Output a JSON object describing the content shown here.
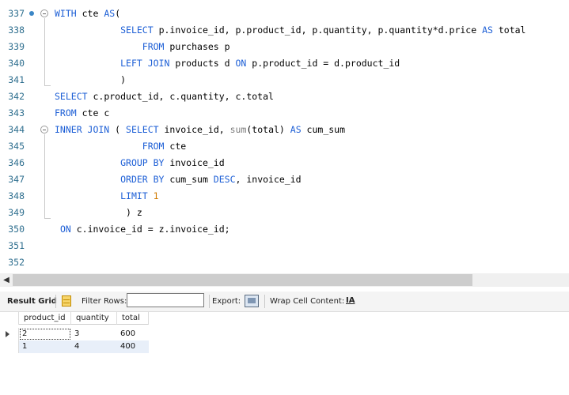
{
  "editor": {
    "lines": [
      {
        "num": "337",
        "tokens": [
          {
            "t": "WITH",
            "c": "kw"
          },
          {
            "t": " cte "
          },
          {
            "t": "AS",
            "c": "kw"
          },
          {
            "t": "("
          }
        ]
      },
      {
        "num": "338",
        "tokens": [
          {
            "t": "            "
          },
          {
            "t": "SELECT",
            "c": "kw"
          },
          {
            "t": " p.invoice_id, p.product_id, p.quantity, p.quantity*d.price "
          },
          {
            "t": "AS",
            "c": "kw"
          },
          {
            "t": " total"
          }
        ]
      },
      {
        "num": "339",
        "tokens": [
          {
            "t": "                "
          },
          {
            "t": "FROM",
            "c": "kw"
          },
          {
            "t": " purchases p"
          }
        ]
      },
      {
        "num": "340",
        "tokens": [
          {
            "t": "            "
          },
          {
            "t": "LEFT JOIN",
            "c": "kw"
          },
          {
            "t": " products d "
          },
          {
            "t": "ON",
            "c": "kw"
          },
          {
            "t": " p.product_id = d.product_id"
          }
        ]
      },
      {
        "num": "341",
        "tokens": [
          {
            "t": "            )"
          }
        ]
      },
      {
        "num": "342",
        "tokens": [
          {
            "t": "SELECT",
            "c": "kw"
          },
          {
            "t": " c.product_id, c.quantity, c.total"
          }
        ]
      },
      {
        "num": "343",
        "tokens": [
          {
            "t": "FROM",
            "c": "kw"
          },
          {
            "t": " cte c"
          }
        ]
      },
      {
        "num": "344",
        "tokens": [
          {
            "t": "INNER JOIN",
            "c": "kw"
          },
          {
            "t": " ( "
          },
          {
            "t": "SELECT",
            "c": "kw"
          },
          {
            "t": " invoice_id, "
          },
          {
            "t": "sum",
            "c": "fn"
          },
          {
            "t": "(total) "
          },
          {
            "t": "AS",
            "c": "kw"
          },
          {
            "t": " cum_sum"
          }
        ]
      },
      {
        "num": "345",
        "tokens": [
          {
            "t": "                "
          },
          {
            "t": "FROM",
            "c": "kw"
          },
          {
            "t": " cte"
          }
        ]
      },
      {
        "num": "346",
        "tokens": [
          {
            "t": "            "
          },
          {
            "t": "GROUP BY",
            "c": "kw"
          },
          {
            "t": " invoice_id"
          }
        ]
      },
      {
        "num": "347",
        "tokens": [
          {
            "t": "            "
          },
          {
            "t": "ORDER BY",
            "c": "kw"
          },
          {
            "t": " cum_sum "
          },
          {
            "t": "DESC",
            "c": "kw"
          },
          {
            "t": ", invoice_id"
          }
        ]
      },
      {
        "num": "348",
        "tokens": [
          {
            "t": "            "
          },
          {
            "t": "LIMIT",
            "c": "kw"
          },
          {
            "t": " "
          },
          {
            "t": "1",
            "c": "num"
          }
        ]
      },
      {
        "num": "349",
        "tokens": [
          {
            "t": "             ) z"
          }
        ]
      },
      {
        "num": "350",
        "tokens": [
          {
            "t": " "
          },
          {
            "t": "ON",
            "c": "kw"
          },
          {
            "t": " c.invoice_id = z.invoice_id;"
          }
        ]
      },
      {
        "num": "351",
        "tokens": []
      },
      {
        "num": "352",
        "tokens": []
      }
    ]
  },
  "toolbar": {
    "result_grid_label": "Result Grid",
    "filter_rows_label": "Filter Rows:",
    "filter_value": "",
    "export_label": "Export:",
    "wrap_label": "Wrap Cell Content:",
    "wrap_icon_text": "IA"
  },
  "grid": {
    "columns": [
      "product_id",
      "quantity",
      "total"
    ],
    "rows": [
      [
        "2",
        "3",
        "600"
      ],
      [
        "1",
        "4",
        "400"
      ]
    ]
  },
  "colors": {
    "keyword": "#1d5fd6",
    "function": "#7a7a7a",
    "number": "#d07a00",
    "line_number": "#2f6f8f",
    "alt_row": "#e8eff9"
  },
  "icons": [
    "breakpoint-dot-icon",
    "fold-toggle-icon",
    "scroll-left-icon",
    "result-grid-icon",
    "export-icon",
    "wrap-cell-icon",
    "current-row-arrow-icon"
  ]
}
